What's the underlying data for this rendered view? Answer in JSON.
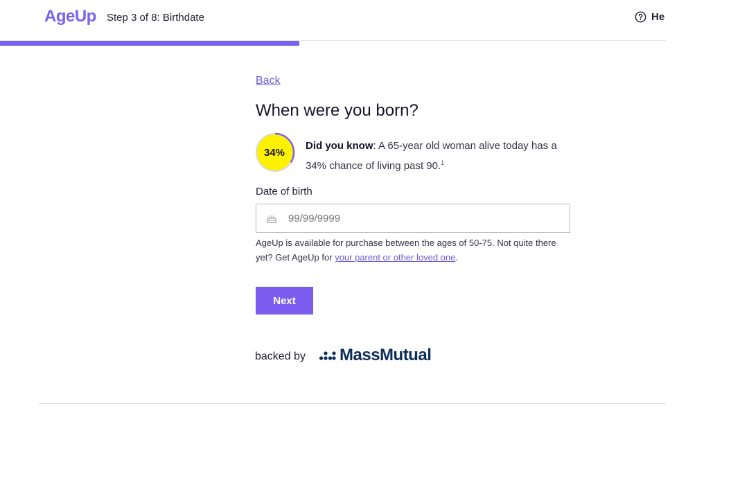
{
  "header": {
    "logo": "AgeUp",
    "step_text": "Step 3 of 8: Birthdate",
    "help_label": "He"
  },
  "progress": {
    "fraction": 0.45
  },
  "main": {
    "back_label": "Back",
    "question": "When were you born?",
    "stat": {
      "value": "34%",
      "percent": 34,
      "fact_lead": "Did you know",
      "fact_text": ": A 65-year old woman alive today has a 34% chance of living past 90.",
      "footnote": "1"
    },
    "dob": {
      "label": "Date of birth",
      "placeholder": "99/99/9999",
      "value": ""
    },
    "availability": {
      "text_before": "AgeUp is available for purchase between the ages of 50-75. Not quite there yet? Get AgeUp for ",
      "link_text": "your parent or other loved one",
      "text_after": "."
    },
    "next_label": "Next"
  },
  "footer": {
    "backed_by": "backed by",
    "brand": "MassMutual"
  },
  "colors": {
    "accent": "#7b61f0",
    "stat_fill": "#fff200",
    "brand_navy": "#0c2c5c",
    "link": "#6d5ad6"
  }
}
